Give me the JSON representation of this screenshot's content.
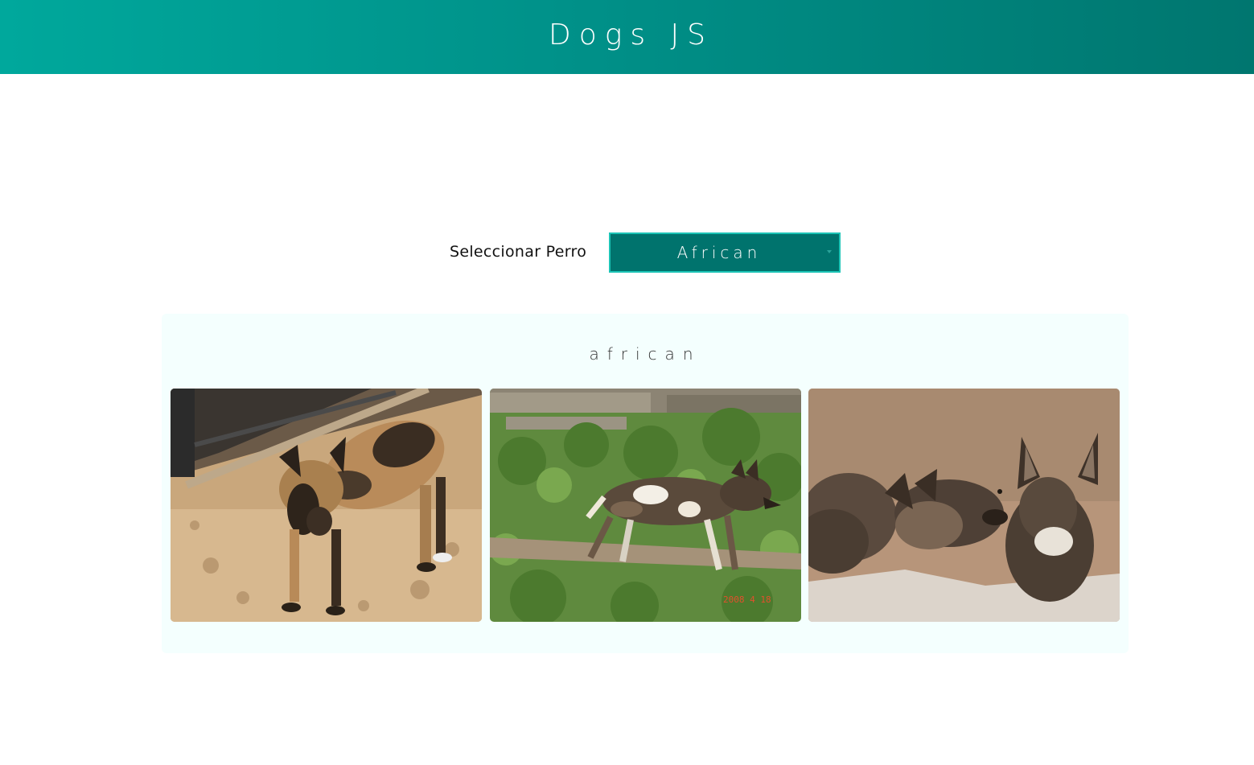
{
  "header": {
    "title": "Dogs JS"
  },
  "selector": {
    "label": "Seleccionar Perro",
    "selected_value": "African"
  },
  "gallery": {
    "breed_title": "african",
    "images": [
      {
        "name": "dog-photo-1"
      },
      {
        "name": "dog-photo-2",
        "stamp": "2008 4 18"
      },
      {
        "name": "dog-photo-3"
      }
    ]
  },
  "colors": {
    "header_gradient_start": "#00a89c",
    "header_gradient_end": "#00766f",
    "select_bg": "#00736d",
    "select_border": "#1cc4b6",
    "card_bg": "#f4fffe"
  }
}
